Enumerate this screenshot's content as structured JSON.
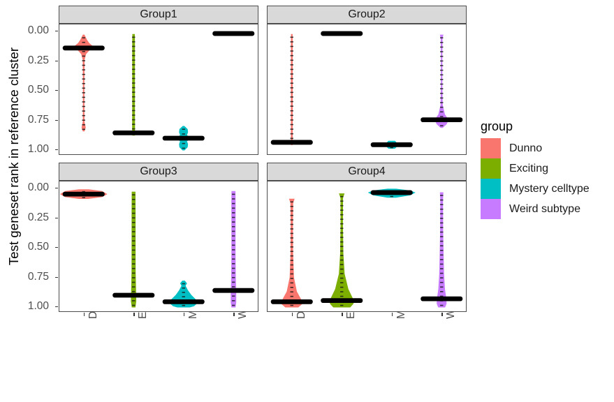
{
  "axis": {
    "y_title": "Test geneset rank in reference cluster",
    "y_ticks": [
      "0.00",
      "0.25",
      "0.50",
      "0.75",
      "1.00"
    ],
    "x_ticks": [
      "Dunno",
      "Exciting",
      "Mystery celltype",
      "Weird subtype"
    ]
  },
  "legend": {
    "title": "group",
    "items": [
      {
        "label": "Dunno",
        "color": "#F8766D"
      },
      {
        "label": "Exciting",
        "color": "#7CAE00"
      },
      {
        "label": "Mystery celltype",
        "color": "#00BFC4"
      },
      {
        "label": "Weird subtype",
        "color": "#C77CFF"
      }
    ]
  },
  "panels": [
    {
      "title": "Group1"
    },
    {
      "title": "Group2"
    },
    {
      "title": "Group3"
    },
    {
      "title": "Group4"
    }
  ],
  "chart_data": {
    "type": "violin",
    "title": "",
    "xlabel": "",
    "ylabel": "Test geneset rank in reference cluster",
    "ylim": [
      0.0,
      1.0
    ],
    "y_reversed": true,
    "y_ticks": [
      0.0,
      0.25,
      0.5,
      0.75,
      1.0
    ],
    "grid": false,
    "legend_position": "right",
    "legend_title": "group",
    "facets": [
      "Group1",
      "Group2",
      "Group3",
      "Group4"
    ],
    "categories": [
      "Dunno",
      "Exciting",
      "Mystery celltype",
      "Weird subtype"
    ],
    "colors": [
      "#F8766D",
      "#7CAE00",
      "#00BFC4",
      "#C77CFF"
    ],
    "series": [
      {
        "facet": "Group1",
        "violins": [
          {
            "category": "Dunno",
            "color": "#F8766D",
            "median": 0.14,
            "min": 0.03,
            "max": 0.84,
            "halfwidth": 0.42,
            "profile": [
              [
                0.03,
                0.06
              ],
              [
                0.07,
                0.3
              ],
              [
                0.1,
                0.55
              ],
              [
                0.13,
                1.0
              ],
              [
                0.16,
                0.55
              ],
              [
                0.19,
                0.22
              ],
              [
                0.24,
                0.06
              ],
              [
                0.4,
                0.04
              ],
              [
                0.6,
                0.04
              ],
              [
                0.76,
                0.05
              ],
              [
                0.81,
                0.18
              ],
              [
                0.84,
                0.06
              ]
            ]
          },
          {
            "category": "Exciting",
            "color": "#7CAE00",
            "median": 0.855,
            "min": 0.025,
            "max": 0.875,
            "halfwidth": 0.07,
            "profile": [
              [
                0.025,
                0.55
              ],
              [
                0.1,
                0.62
              ],
              [
                0.3,
                0.62
              ],
              [
                0.5,
                0.62
              ],
              [
                0.7,
                0.62
              ],
              [
                0.82,
                0.68
              ],
              [
                0.875,
                0.55
              ]
            ]
          },
          {
            "category": "Mystery celltype",
            "color": "#00BFC4",
            "median": 0.9,
            "min": 0.8,
            "max": 1.0,
            "halfwidth": 0.3,
            "profile": [
              [
                0.8,
                0.1
              ],
              [
                0.825,
                0.55
              ],
              [
                0.85,
                0.6
              ],
              [
                0.875,
                0.45
              ],
              [
                0.9,
                0.95
              ],
              [
                0.925,
                0.45
              ],
              [
                0.95,
                0.6
              ],
              [
                0.975,
                0.55
              ],
              [
                1.0,
                0.12
              ]
            ]
          },
          {
            "category": "Weird subtype",
            "color": "#C77CFF",
            "median": 0.018,
            "min": 0.012,
            "max": 0.025,
            "halfwidth": 0.4,
            "profile": [
              [
                0.012,
                0.6
              ],
              [
                0.018,
                1.0
              ],
              [
                0.025,
                0.6
              ]
            ]
          }
        ]
      },
      {
        "facet": "Group2",
        "violins": [
          {
            "category": "Dunno",
            "color": "#F8766D",
            "median": 0.935,
            "min": 0.025,
            "max": 0.955,
            "halfwidth": 0.05,
            "profile": [
              [
                0.025,
                0.4
              ],
              [
                0.1,
                0.45
              ],
              [
                0.3,
                0.45
              ],
              [
                0.5,
                0.45
              ],
              [
                0.7,
                0.45
              ],
              [
                0.9,
                0.48
              ],
              [
                0.955,
                0.4
              ]
            ]
          },
          {
            "category": "Exciting",
            "color": "#7CAE00",
            "median": 0.018,
            "min": 0.012,
            "max": 0.025,
            "halfwidth": 0.52,
            "profile": [
              [
                0.012,
                0.7
              ],
              [
                0.018,
                1.0
              ],
              [
                0.025,
                0.7
              ]
            ]
          },
          {
            "category": "Mystery celltype",
            "color": "#00BFC4",
            "median": 0.955,
            "min": 0.925,
            "max": 0.985,
            "halfwidth": 0.25,
            "profile": [
              [
                0.925,
                0.55
              ],
              [
                0.94,
                0.85
              ],
              [
                0.955,
                1.0
              ],
              [
                0.97,
                0.85
              ],
              [
                0.985,
                0.55
              ]
            ]
          },
          {
            "category": "Weird subtype",
            "color": "#C77CFF",
            "median": 0.745,
            "min": 0.03,
            "max": 0.81,
            "halfwidth": 0.32,
            "profile": [
              [
                0.03,
                0.18
              ],
              [
                0.06,
                0.08
              ],
              [
                0.2,
                0.05
              ],
              [
                0.45,
                0.05
              ],
              [
                0.62,
                0.1
              ],
              [
                0.7,
                0.4
              ],
              [
                0.745,
                0.9
              ],
              [
                0.78,
                0.65
              ],
              [
                0.81,
                0.12
              ]
            ]
          }
        ]
      },
      {
        "facet": "Group3",
        "violins": [
          {
            "category": "Dunno",
            "color": "#F8766D",
            "median": 0.048,
            "min": 0.01,
            "max": 0.085,
            "halfwidth": 1.0,
            "profile": [
              [
                0.01,
                0.2
              ],
              [
                0.025,
                0.8
              ],
              [
                0.048,
                1.0
              ],
              [
                0.07,
                0.8
              ],
              [
                0.085,
                0.2
              ]
            ]
          },
          {
            "category": "Exciting",
            "color": "#7CAE00",
            "median": 0.9,
            "min": 0.03,
            "max": 1.0,
            "halfwidth": 0.12,
            "profile": [
              [
                0.03,
                0.55
              ],
              [
                0.2,
                0.6
              ],
              [
                0.45,
                0.6
              ],
              [
                0.7,
                0.62
              ],
              [
                0.88,
                0.78
              ],
              [
                0.95,
                0.85
              ],
              [
                1.0,
                0.55
              ]
            ]
          },
          {
            "category": "Mystery celltype",
            "color": "#00BFC4",
            "median": 0.955,
            "min": 0.78,
            "max": 1.0,
            "halfwidth": 0.6,
            "profile": [
              [
                0.78,
                0.08
              ],
              [
                0.8,
                0.22
              ],
              [
                0.82,
                0.12
              ],
              [
                0.86,
                0.3
              ],
              [
                0.9,
                0.55
              ],
              [
                0.94,
                0.9
              ],
              [
                0.965,
                1.0
              ],
              [
                0.99,
                0.75
              ],
              [
                1.0,
                0.45
              ]
            ]
          },
          {
            "category": "Weird subtype",
            "color": "#C77CFF",
            "median": 0.86,
            "min": 0.025,
            "max": 1.0,
            "halfwidth": 0.13,
            "profile": [
              [
                0.025,
                0.55
              ],
              [
                0.12,
                0.6
              ],
              [
                0.35,
                0.58
              ],
              [
                0.55,
                0.58
              ],
              [
                0.75,
                0.65
              ],
              [
                0.88,
                0.8
              ],
              [
                0.96,
                0.8
              ],
              [
                1.0,
                0.58
              ]
            ]
          }
        ]
      },
      {
        "facet": "Group4",
        "violins": [
          {
            "category": "Dunno",
            "color": "#F8766D",
            "median": 0.955,
            "min": 0.09,
            "max": 1.0,
            "halfwidth": 0.46,
            "profile": [
              [
                0.09,
                0.22
              ],
              [
                0.12,
                0.1
              ],
              [
                0.3,
                0.07
              ],
              [
                0.55,
                0.09
              ],
              [
                0.75,
                0.17
              ],
              [
                0.87,
                0.45
              ],
              [
                0.94,
                0.88
              ],
              [
                0.97,
                1.0
              ],
              [
                1.0,
                0.6
              ]
            ]
          },
          {
            "category": "Exciting",
            "color": "#7CAE00",
            "median": 0.945,
            "min": 0.045,
            "max": 1.0,
            "halfwidth": 0.5,
            "profile": [
              [
                0.045,
                0.2
              ],
              [
                0.08,
                0.08
              ],
              [
                0.3,
                0.07
              ],
              [
                0.55,
                0.11
              ],
              [
                0.72,
                0.22
              ],
              [
                0.85,
                0.55
              ],
              [
                0.93,
                0.95
              ],
              [
                0.97,
                1.0
              ],
              [
                1.0,
                0.72
              ]
            ]
          },
          {
            "category": "Mystery celltype",
            "color": "#00BFC4",
            "median": 0.035,
            "min": 0.005,
            "max": 0.075,
            "halfwidth": 1.0,
            "profile": [
              [
                0.005,
                0.18
              ],
              [
                0.02,
                0.8
              ],
              [
                0.035,
                1.0
              ],
              [
                0.055,
                0.8
              ],
              [
                0.075,
                0.18
              ]
            ]
          },
          {
            "category": "Weird subtype",
            "color": "#C77CFF",
            "median": 0.93,
            "min": 0.035,
            "max": 1.0,
            "halfwidth": 0.2,
            "profile": [
              [
                0.035,
                0.3
              ],
              [
                0.1,
                0.22
              ],
              [
                0.35,
                0.25
              ],
              [
                0.55,
                0.35
              ],
              [
                0.72,
                0.45
              ],
              [
                0.85,
                0.65
              ],
              [
                0.93,
                0.95
              ],
              [
                0.97,
                1.0
              ],
              [
                1.0,
                0.7
              ]
            ]
          }
        ]
      }
    ]
  }
}
